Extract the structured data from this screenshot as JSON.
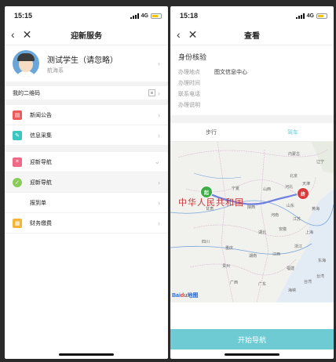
{
  "left": {
    "status": {
      "time": "15:15",
      "network": "4G"
    },
    "nav": {
      "back": "‹",
      "close": "✕",
      "title": "迎新服务"
    },
    "profile": {
      "name": "测试学生（请忽略）",
      "dept": "航海系"
    },
    "qr": {
      "label": "我的二维码"
    },
    "group1": [
      {
        "label": "新闻公告",
        "icon_color": "#ef5a5a",
        "glyph": "▤"
      },
      {
        "label": "信息采集",
        "icon_color": "#3cc6c0",
        "glyph": "✎"
      }
    ],
    "group2": [
      {
        "label": "迎新导航",
        "icon_color": "#ef6a86",
        "glyph": "⌗",
        "chev": "⌄"
      },
      {
        "label": "迎新导航",
        "icon_color": "#88cc5a",
        "glyph": "✓",
        "chev": "›",
        "selected": true
      },
      {
        "label": "报到单",
        "icon_color": "transparent",
        "glyph": "",
        "chev": "›"
      },
      {
        "label": "财务缴费",
        "icon_color": "#f4b43a",
        "glyph": "▦",
        "chev": "›"
      }
    ],
    "colors": {
      "accent": "#5fc8d0"
    }
  },
  "right": {
    "status": {
      "time": "15:18",
      "network": "4G"
    },
    "nav": {
      "back": "‹",
      "close": "✕",
      "title": "查看"
    },
    "section": {
      "title": "身份核验"
    },
    "info": [
      {
        "label": "办理地点",
        "value": "图文信息中心"
      },
      {
        "label": "办理时间",
        "value": ""
      },
      {
        "label": "联系电话",
        "value": ""
      },
      {
        "label": "办理说明",
        "value": ""
      }
    ],
    "tabs": [
      {
        "label": "步行",
        "active": false
      },
      {
        "label": "驾车",
        "active": true
      }
    ],
    "map": {
      "country": "中华人民共和国",
      "start_pin": "起",
      "end_pin": "终",
      "logo_a": "Bai",
      "logo_b": "du",
      "logo_c": "地图",
      "places": [
        "内蒙古",
        "辽宁",
        "北京",
        "宁夏",
        "山西",
        "河北",
        "天津",
        "甘肃",
        "陕西",
        "山东",
        "河南",
        "江苏",
        "黄海",
        "四川",
        "湖北",
        "安徽",
        "上海",
        "重庆",
        "湖南",
        "江西",
        "浙江",
        "贵州",
        "福建",
        "东海",
        "台湾",
        "广西",
        "广东",
        "台湾",
        "海峡"
      ]
    },
    "action": {
      "label": "开始导航"
    }
  }
}
